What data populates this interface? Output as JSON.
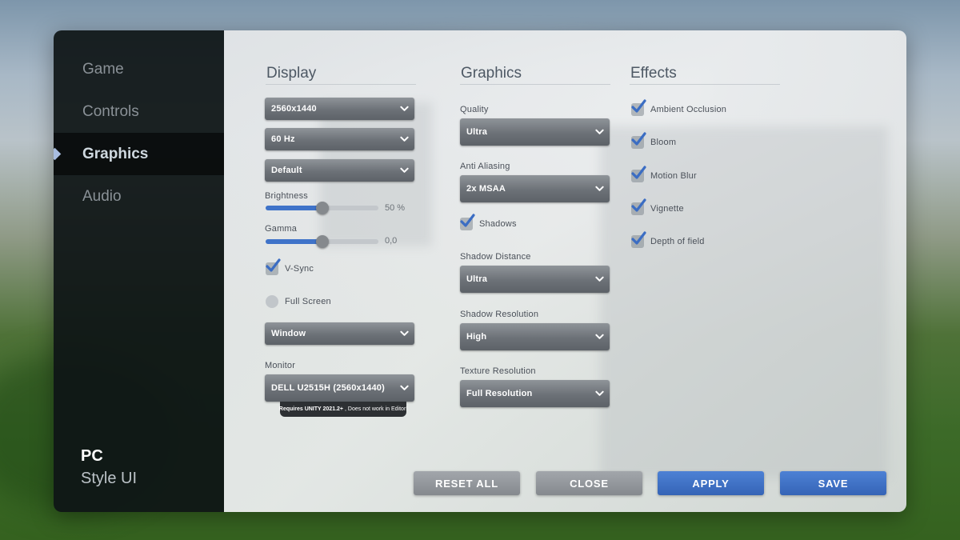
{
  "sidebar": {
    "items": [
      {
        "label": "Game"
      },
      {
        "label": "Controls"
      },
      {
        "label": "Graphics"
      },
      {
        "label": "Audio"
      }
    ],
    "active_item": "Graphics",
    "brand": {
      "title": "PC",
      "subtitle": "Style UI"
    }
  },
  "display": {
    "title": "Display",
    "resolution": "2560x1440",
    "refresh_rate": "60 Hz",
    "preset": "Default",
    "brightness": {
      "label": "Brightness",
      "value_text": "50 %",
      "fraction": 0.5
    },
    "gamma": {
      "label": "Gamma",
      "value_text": "0,0",
      "fraction": 0.5
    },
    "vsync": {
      "label": "V-Sync",
      "checked": true
    },
    "fullscreen": {
      "label": "Full Screen",
      "checked": false
    },
    "window_mode": "Window",
    "monitor": {
      "label": "Monitor",
      "value": "DELL U2515H (2560x1440)",
      "tooltip_bold": "Requires UNITY 2021.2+",
      "tooltip_rest": ", Does not work in Editor!"
    }
  },
  "graphics": {
    "title": "Graphics",
    "quality": {
      "label": "Quality",
      "value": "Ultra"
    },
    "anti_aliasing": {
      "label": "Anti Aliasing",
      "value": "2x MSAA"
    },
    "shadows": {
      "label": "Shadows",
      "checked": true
    },
    "shadow_distance": {
      "label": "Shadow Distance",
      "value": "Ultra"
    },
    "shadow_resolution": {
      "label": "Shadow Resolution",
      "value": "High"
    },
    "texture_resolution": {
      "label": "Texture Resolution",
      "value": "Full Resolution"
    }
  },
  "effects": {
    "title": "Effects",
    "items": [
      {
        "label": "Ambient Occlusion",
        "checked": true
      },
      {
        "label": "Bloom",
        "checked": true
      },
      {
        "label": "Motion Blur",
        "checked": true
      },
      {
        "label": "Vignette",
        "checked": true
      },
      {
        "label": "Depth of field",
        "checked": true
      }
    ]
  },
  "buttons": {
    "reset": "RESET ALL",
    "close": "CLOSE",
    "apply": "APPLY",
    "save": "SAVE"
  },
  "colors": {
    "accent": "#3f73c9",
    "check": "#3b6dc3",
    "sidebar_bg": "#0e1416"
  }
}
